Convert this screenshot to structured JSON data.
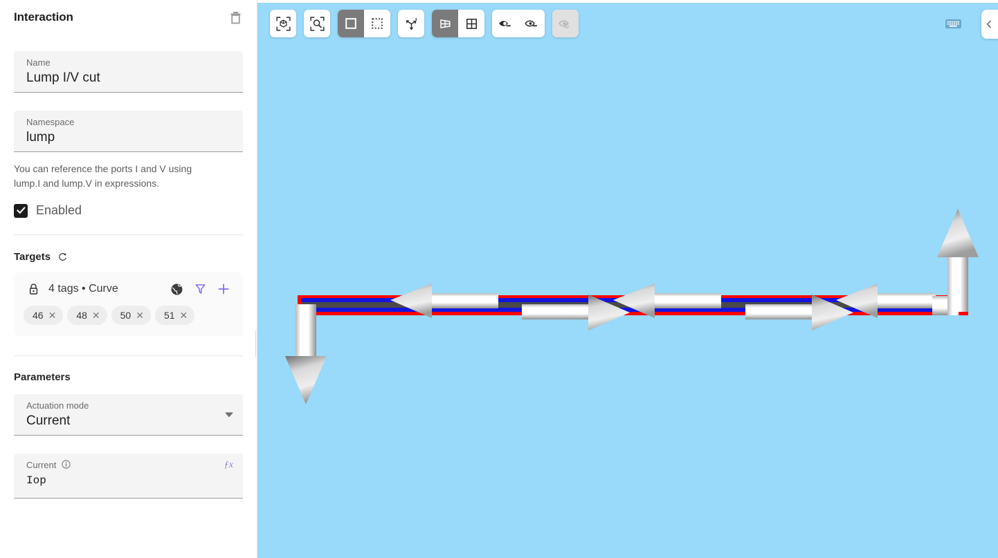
{
  "panel": {
    "title": "Interaction",
    "delete_icon": "trash-icon",
    "fields": {
      "name": {
        "label": "Name",
        "value": "Lump I/V cut"
      },
      "namespace": {
        "label": "Namespace",
        "value": "lump"
      }
    },
    "hint": "You can reference the ports I and V using lump.I and lump.V in expressions.",
    "enabled": {
      "label": "Enabled",
      "checked": true
    },
    "targets": {
      "section_title": "Targets",
      "refresh_icon": "refresh-icon",
      "lock_icon": "lock-icon",
      "summary": "4 tags • Curve",
      "globe_icon": "globe-icon",
      "filter_icon": "filter-icon",
      "add_icon": "plus-icon",
      "chips": [
        {
          "label": "46",
          "remove": "✕"
        },
        {
          "label": "48",
          "remove": "✕"
        },
        {
          "label": "50",
          "remove": "✕"
        },
        {
          "label": "51",
          "remove": "✕"
        }
      ]
    },
    "parameters": {
      "section_title": "Parameters",
      "actuation_mode": {
        "label": "Actuation mode",
        "value": "Current"
      },
      "current": {
        "label": "Current",
        "value": "Iop",
        "fx": "ƒx"
      }
    }
  },
  "viewport": {
    "background_color": "#99d9f9",
    "toolbar": [
      {
        "name": "fit-to-view-button",
        "icon": "cube-focus-icon",
        "active": false,
        "disabled": false
      },
      {
        "name": "zoom-to-region-button",
        "icon": "magnifier-focus-icon",
        "active": false,
        "disabled": false
      },
      {
        "name": "select-solid-button",
        "icon": "solid-square-icon",
        "active": true,
        "disabled": false
      },
      {
        "name": "select-marquee-button",
        "icon": "dashed-square-icon",
        "active": false,
        "disabled": false
      },
      {
        "name": "axes-button",
        "icon": "axes-icon",
        "active": false,
        "disabled": false
      },
      {
        "name": "perspective-view-button",
        "icon": "perspective-grid-icon",
        "active": true,
        "disabled": false
      },
      {
        "name": "ortho-view-button",
        "icon": "grid-four-icon",
        "active": false,
        "disabled": false
      },
      {
        "name": "show-all-button",
        "icon": "eye-filled-icon",
        "active": false,
        "disabled": false
      },
      {
        "name": "hide-all-button",
        "icon": "eye-outline-icon",
        "active": false,
        "disabled": false
      },
      {
        "name": "reset-visibility-button",
        "icon": "eye-refresh-icon",
        "active": false,
        "disabled": true
      }
    ],
    "keyboard_shortcuts_icon": "keyboard-icon",
    "edge_panel_icon": "chevron-left-icon",
    "scene": {
      "wire_colors": {
        "outer": "#ff0000",
        "inner": "#1414e0",
        "core": "#4a4a4a"
      },
      "arrow_color": "#f2f2f2",
      "arrow_shadow": "#8a8a8a"
    }
  }
}
